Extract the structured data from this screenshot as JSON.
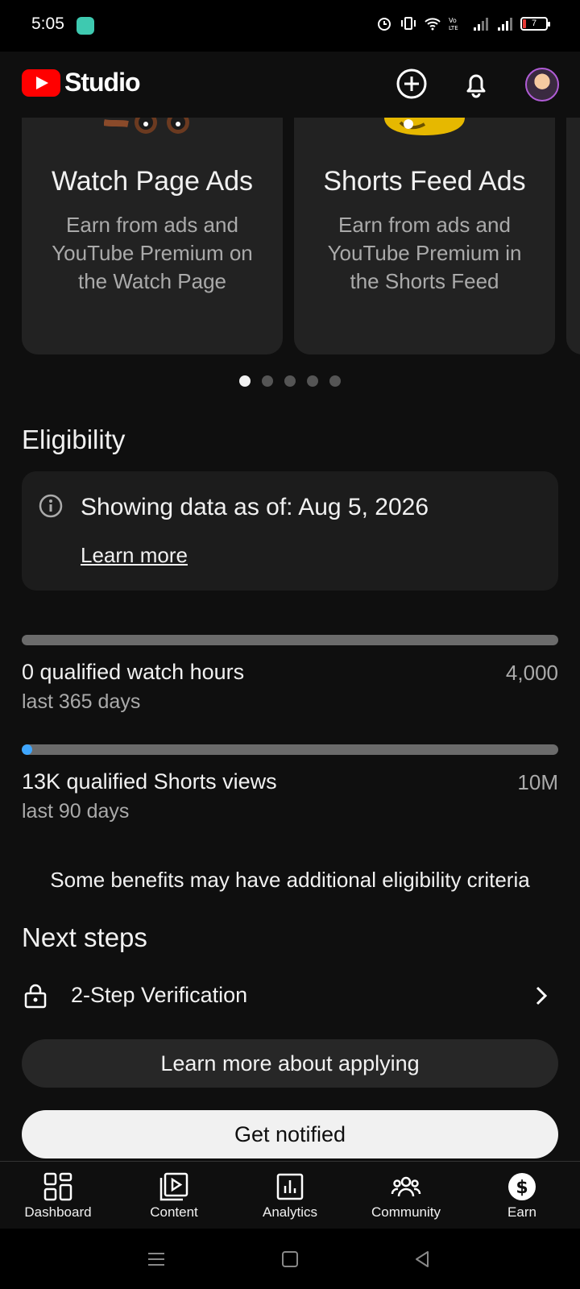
{
  "status_bar": {
    "time": "5:05",
    "battery": "7"
  },
  "app": {
    "name": "Studio"
  },
  "cards": [
    {
      "title": "Watch Page Ads",
      "description": "Earn from ads and YouTube Premium on the Watch Page"
    },
    {
      "title": "Shorts Feed Ads",
      "description": "Earn from ads and YouTube Premium in the Shorts Feed"
    }
  ],
  "carousel": {
    "count": 5,
    "active_index": 0
  },
  "eligibility": {
    "title": "Eligibility",
    "info_text": "Showing data as of: Aug 5, 2026",
    "learn_more": "Learn more",
    "metrics": [
      {
        "label": "0 qualified watch hours",
        "sub": "last 365 days",
        "goal": "4,000",
        "progress": 0.0
      },
      {
        "label": "13K qualified Shorts views",
        "sub": "last 90 days",
        "goal": "10M",
        "progress": 0.0013
      }
    ],
    "note": "Some benefits may have additional eligibility criteria"
  },
  "next_steps": {
    "title": "Next steps",
    "items": [
      {
        "label": "2-Step Verification"
      }
    ]
  },
  "buttons": {
    "learn_more_applying": "Learn more about applying",
    "get_notified": "Get notified"
  },
  "bottom_nav": [
    {
      "label": "Dashboard",
      "icon": "dashboard-icon"
    },
    {
      "label": "Content",
      "icon": "content-icon"
    },
    {
      "label": "Analytics",
      "icon": "analytics-icon"
    },
    {
      "label": "Community",
      "icon": "community-icon"
    },
    {
      "label": "Earn",
      "icon": "earn-icon",
      "active": true
    }
  ],
  "colors": {
    "progress": "#3ea6ff",
    "brand": "#ff0000"
  }
}
